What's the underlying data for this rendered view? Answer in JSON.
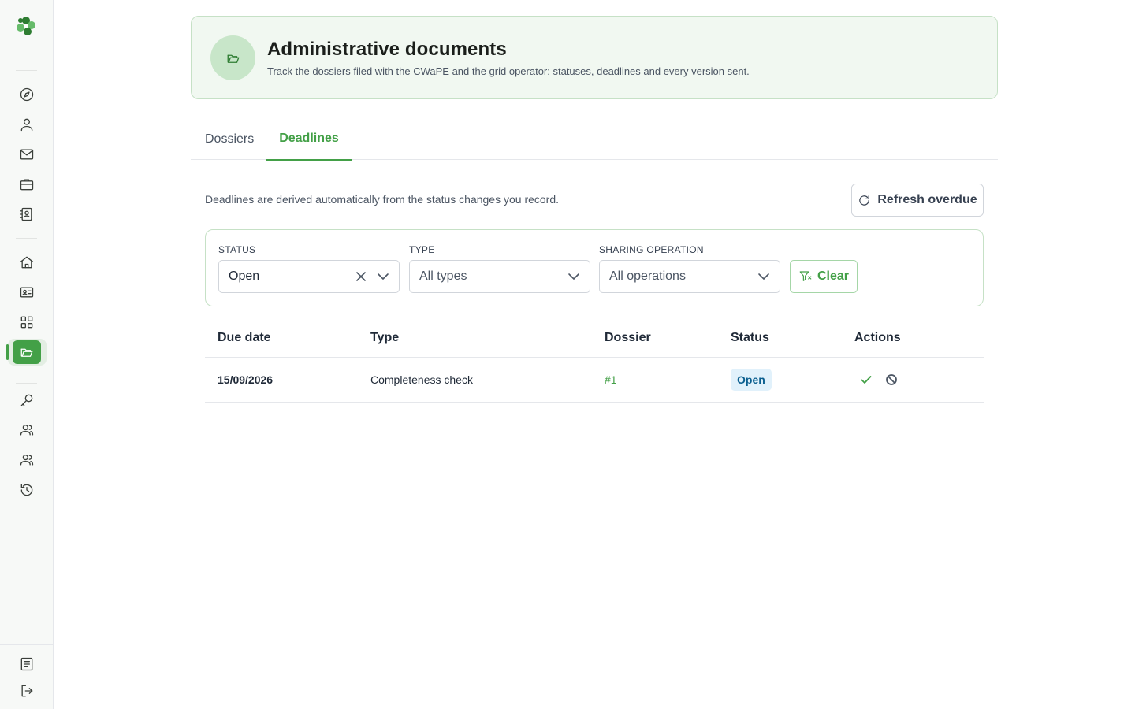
{
  "sidebar": {
    "logo": "clover-logo",
    "items": [
      {
        "icon": "compass-icon"
      },
      {
        "icon": "user-icon"
      },
      {
        "icon": "mail-icon"
      },
      {
        "icon": "briefcase-icon"
      },
      {
        "icon": "contacts-book-icon"
      },
      {
        "icon": "home-icon"
      },
      {
        "icon": "id-card-icon"
      },
      {
        "icon": "apps-grid-icon"
      },
      {
        "icon": "folder-open-icon",
        "active": true
      },
      {
        "icon": "key-icon"
      },
      {
        "icon": "users-icon"
      },
      {
        "icon": "users-alt-icon"
      },
      {
        "icon": "history-icon"
      },
      {
        "icon": "document-icon"
      },
      {
        "icon": "logout-icon"
      }
    ],
    "accent": "#43a047"
  },
  "header": {
    "title": "Administrative documents",
    "subtitle": "Track the dossiers filed with the CWaPE and the grid operator: statuses, deadlines and every version sent.",
    "icon": "folder-open-icon"
  },
  "tabs": [
    {
      "label": "Dossiers",
      "active": false
    },
    {
      "label": "Deadlines",
      "active": true
    }
  ],
  "info_text": "Deadlines are derived automatically from the status changes you record.",
  "refresh_button": {
    "label": "Refresh overdue",
    "icon": "refresh-icon"
  },
  "filters": {
    "status": {
      "label": "STATUS",
      "value": "Open"
    },
    "type": {
      "label": "TYPE",
      "placeholder": "All types"
    },
    "sharing_operation": {
      "label": "SHARING OPERATION",
      "placeholder": "All operations"
    },
    "clear_button": {
      "label": "Clear",
      "icon": "filter-clear-icon"
    }
  },
  "table": {
    "columns": [
      "Due date",
      "Type",
      "Dossier",
      "Status",
      "Actions"
    ],
    "rows": [
      {
        "due_date": "15/09/2026",
        "type": "Completeness check",
        "dossier": "#1",
        "status": "Open"
      }
    ]
  },
  "colors": {
    "accent": "#43a047",
    "header_bg": "#f1f8f1",
    "badge_bg": "#e1f1fb",
    "badge_text": "#0b5f8f"
  }
}
